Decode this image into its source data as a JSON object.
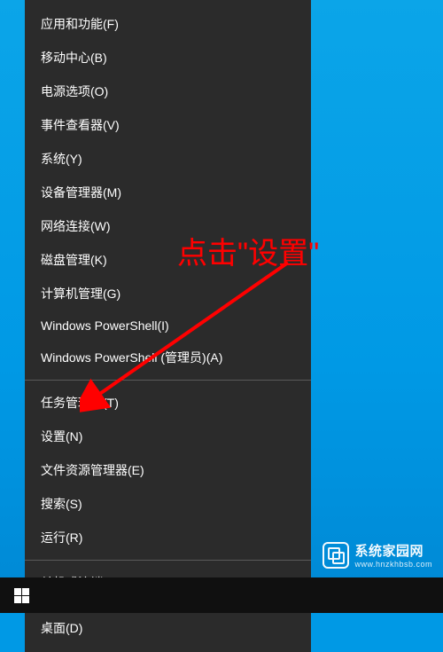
{
  "menu": {
    "section1": [
      "应用和功能(F)",
      "移动中心(B)",
      "电源选项(O)",
      "事件查看器(V)",
      "系统(Y)",
      "设备管理器(M)",
      "网络连接(W)",
      "磁盘管理(K)",
      "计算机管理(G)",
      "Windows PowerShell(I)",
      "Windows PowerShell (管理员)(A)"
    ],
    "section2": [
      "任务管理器(T)",
      "设置(N)",
      "文件资源管理器(E)",
      "搜索(S)",
      "运行(R)"
    ],
    "section3": [
      "关机或注销(U)"
    ],
    "section4": [
      "桌面(D)"
    ]
  },
  "annotation": {
    "text": "点击\"设置\""
  },
  "watermark": {
    "title": "系统家园网",
    "url": "www.hnzkhbsb.com"
  }
}
